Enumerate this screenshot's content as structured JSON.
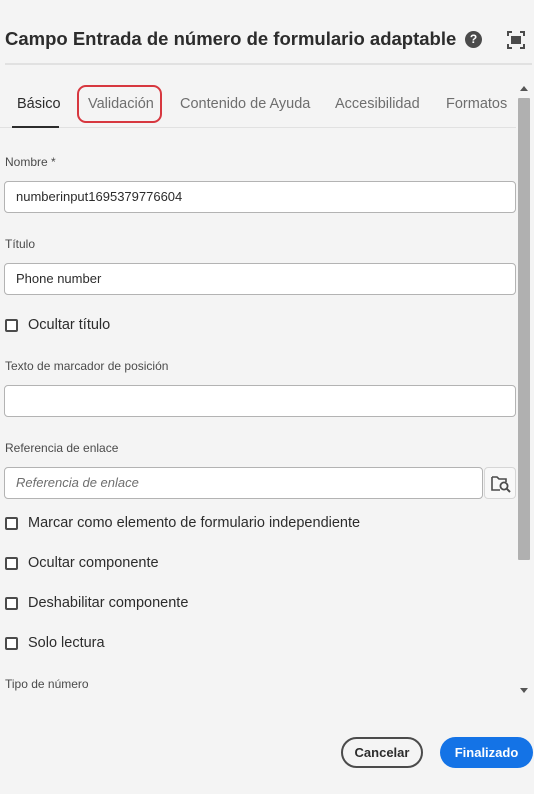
{
  "dialog": {
    "title": "Campo Entrada de número de formulario adaptable",
    "help_icon": "help-icon",
    "fullscreen_icon": "fullscreen-icon"
  },
  "tabs": [
    {
      "label": "Básico",
      "selected": true
    },
    {
      "label": "Validación",
      "selected": false
    },
    {
      "label": "Contenido de Ayuda",
      "selected": false
    },
    {
      "label": "Accesibilidad",
      "selected": false
    },
    {
      "label": "Formatos",
      "selected": false
    }
  ],
  "form": {
    "name": {
      "label": "Nombre *",
      "value": "numberinput1695379776604"
    },
    "title": {
      "label": "Título",
      "value": "Phone number"
    },
    "hide_title": {
      "label": "Ocultar título",
      "checked": false
    },
    "placeholder": {
      "label": "Texto de marcador de posición",
      "value": ""
    },
    "bind_ref": {
      "label": "Referencia de enlace",
      "placeholder": "Referencia de enlace",
      "icon": "folder-search-icon"
    },
    "standalone": {
      "label": "Marcar como elemento de formulario independiente",
      "checked": false
    },
    "hide_component": {
      "label": "Ocultar componente",
      "checked": false
    },
    "disable_component": {
      "label": "Deshabilitar componente",
      "checked": false
    },
    "read_only": {
      "label": "Solo lectura",
      "checked": false
    },
    "number_type": {
      "label": "Tipo de número"
    }
  },
  "footer": {
    "cancel_label": "Cancelar",
    "done_label": "Finalizado"
  },
  "colors": {
    "accent": "#1473e6",
    "highlight": "#d7373f",
    "background": "#f4f4f4"
  }
}
